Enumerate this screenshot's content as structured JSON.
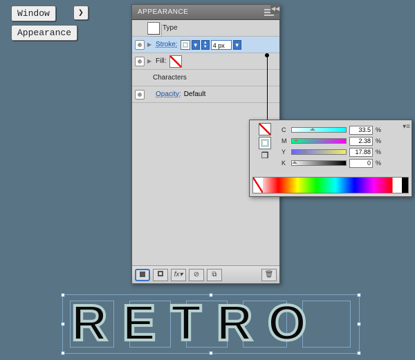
{
  "menu": {
    "window": "Window",
    "appearance": "Appearance",
    "arrow": "❯"
  },
  "panel": {
    "title": "APPEARANCE",
    "type_label": "Type",
    "stroke_label": "Stroke:",
    "stroke_weight": "4 px",
    "fill_label": "Fill:",
    "characters_label": "Characters",
    "opacity_label": "Opacity:",
    "opacity_value": "Default",
    "footer": {
      "fx": "fx▾"
    }
  },
  "color": {
    "channels": [
      {
        "ch": "C",
        "val": "33.5",
        "pos": 33.5
      },
      {
        "ch": "M",
        "val": "2.38",
        "pos": 2.38
      },
      {
        "ch": "Y",
        "val": "17.88",
        "pos": 17.88
      },
      {
        "ch": "K",
        "val": "0",
        "pos": 0
      }
    ],
    "pct": "%"
  },
  "artwork": {
    "text": "RETRO",
    "stroke_color": "#b7d1d0",
    "fill_color": "#0a0a0a"
  }
}
